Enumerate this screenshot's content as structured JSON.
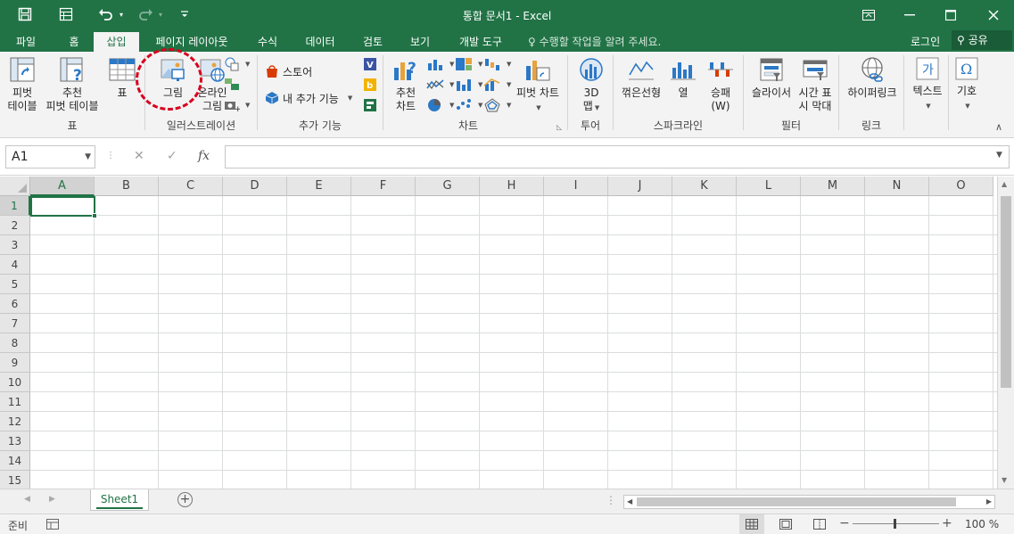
{
  "window": {
    "title": "통합 문서1 - Excel",
    "accent": "#217346",
    "annotation_color": "#d8001c"
  },
  "quick_access": {
    "save_icon": "save-icon",
    "form_icon": "form-icon",
    "undo_icon": "undo-icon",
    "redo_icon": "redo-icon",
    "customize_icon": "customize-icon"
  },
  "tabs": [
    {
      "label": "파일"
    },
    {
      "label": "홈"
    },
    {
      "label": "삽입"
    },
    {
      "label": "페이지 레이아웃"
    },
    {
      "label": "수식"
    },
    {
      "label": "데이터"
    },
    {
      "label": "검토"
    },
    {
      "label": "보기"
    },
    {
      "label": "개발 도구"
    }
  ],
  "tell_me": "수행할 작업을 알려 주세요.",
  "signin": "로그인",
  "share": "공유",
  "ribbon": {
    "tables": {
      "label": "표",
      "pivot_line1": "피벗",
      "pivot_line2": "테이블",
      "rec_pivot_line1": "추천",
      "rec_pivot_line2": "피벗 테이블",
      "table": "표"
    },
    "illustrations": {
      "label": "일러스트레이션",
      "picture": "그림",
      "online_line1": "온라인",
      "online_line2": "그림"
    },
    "addins": {
      "label": "추가 기능",
      "store": "스토어",
      "my_addins": "내 추가 기능"
    },
    "charts": {
      "label": "차트",
      "recommended_line1": "추천",
      "recommended_line2": "차트",
      "pivot_chart": "피벗 차트"
    },
    "tours": {
      "label": "투어",
      "map_line1": "3D",
      "map_line2": "맵"
    },
    "sparklines": {
      "label": "스파크라인",
      "line": "꺾은선형",
      "column": "열",
      "winloss_line1": "승패",
      "winloss_line2": "(W)"
    },
    "filters": {
      "label": "필터",
      "slicer": "슬라이서",
      "timeline_line1": "시간 표",
      "timeline_line2": "시 막대"
    },
    "links": {
      "label": "링크",
      "hyperlink": "하이퍼링크"
    },
    "text": {
      "label": "텍스트"
    },
    "symbols": {
      "label": "기호"
    }
  },
  "formula_bar": {
    "name_box": "A1",
    "cancel": "✕",
    "enter": "✓",
    "fx": "fx",
    "formula": ""
  },
  "grid": {
    "columns": [
      "A",
      "B",
      "C",
      "D",
      "E",
      "F",
      "G",
      "H",
      "I",
      "J",
      "K",
      "L",
      "M",
      "N",
      "O"
    ],
    "rows": [
      "1",
      "2",
      "3",
      "4",
      "5",
      "6",
      "7",
      "8",
      "9",
      "10",
      "11",
      "12",
      "13",
      "14",
      "15"
    ],
    "active_cell": "A1"
  },
  "sheets": [
    {
      "label": "Sheet1"
    }
  ],
  "status": {
    "ready": "준비",
    "zoom": "100 %",
    "zoom_minus": "−",
    "zoom_plus": "+"
  }
}
